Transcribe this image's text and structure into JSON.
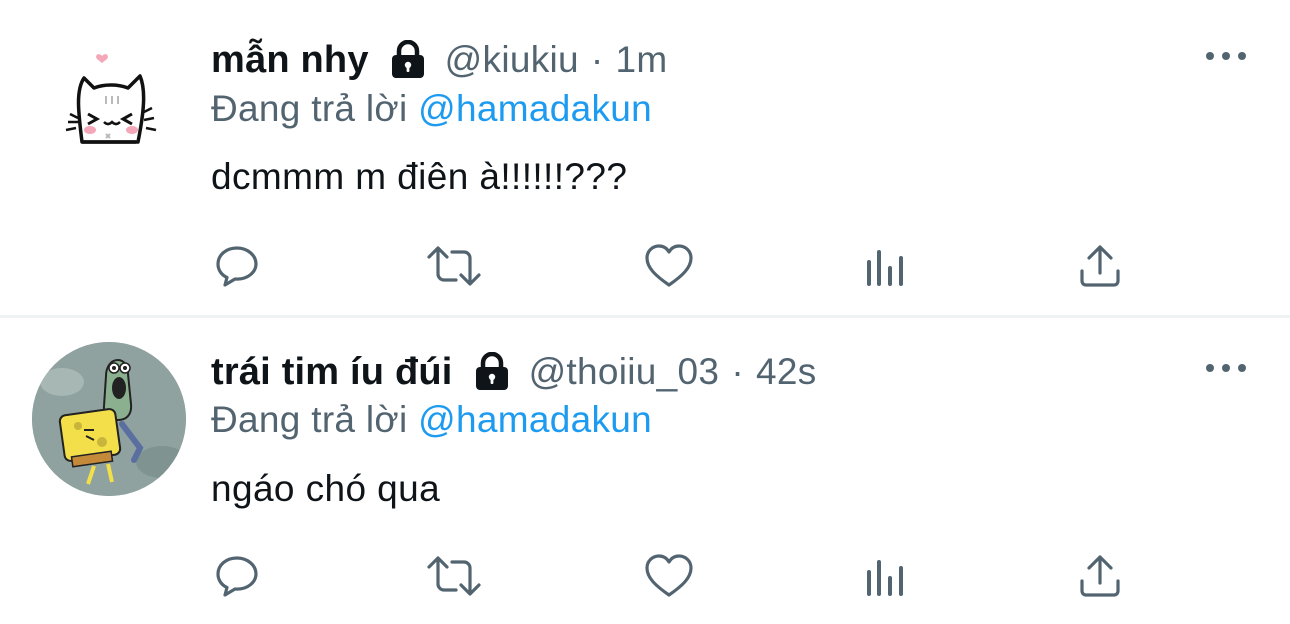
{
  "tweets": [
    {
      "display_name": "mẫn nhy",
      "handle": "@kiukiu",
      "separator": "·",
      "time": "1m",
      "replying_prefix": "Đang trả lời",
      "replying_to": "@hamadakun",
      "text": "dcmmm m điên à!!!!!!???",
      "protected_icon": "lock-icon",
      "avatar": "cat-doodle-avatar"
    },
    {
      "display_name": "trái tim íu đúi",
      "handle": "@thoiiu_03",
      "separator": "·",
      "time": "42s",
      "replying_prefix": "Đang trả lời",
      "replying_to": "@hamadakun",
      "text": "ngáo chó qua",
      "protected_icon": "lock-icon",
      "avatar": "cartoon-avatar"
    }
  ],
  "action_icons": [
    "reply-icon",
    "retweet-icon",
    "like-icon",
    "analytics-icon",
    "share-icon"
  ],
  "colors": {
    "text_primary": "#0f1419",
    "text_secondary": "#536471",
    "mention": "#1d9bf0",
    "divider": "#eff3f4",
    "background": "#ffffff"
  }
}
